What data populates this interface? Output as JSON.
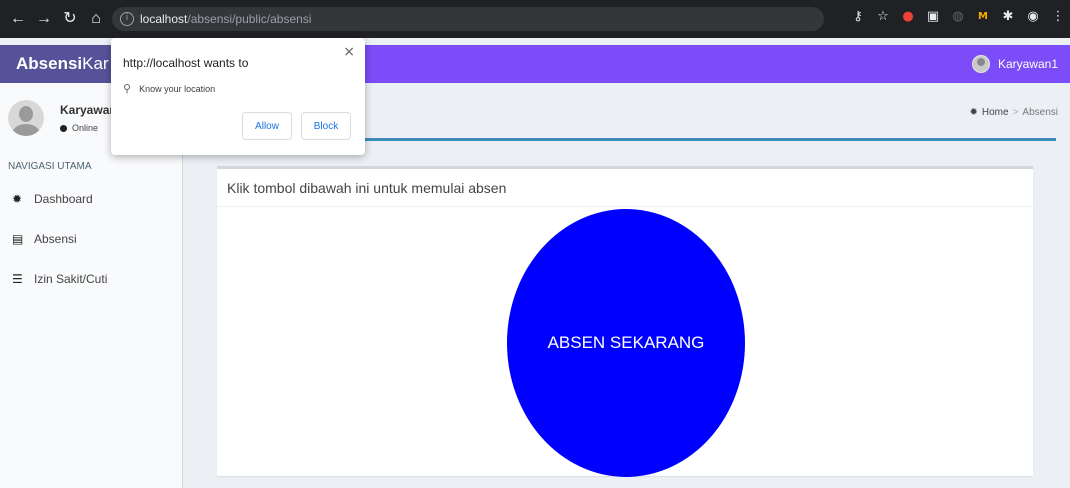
{
  "browser": {
    "url_host": "localhost",
    "url_path": "/absensi/public/absensi",
    "colors": {
      "chrome_bg": "#202124",
      "omnibox_bg": "#35363a"
    }
  },
  "app": {
    "logo_bold": "Absensi",
    "logo_light": "Kar",
    "user_name": "Karyawan1",
    "header_color": "#7b4cf7"
  },
  "sidebar": {
    "user_name": "Karyawan1",
    "user_status": "Online",
    "nav_header": "NAVIGASI UTAMA",
    "items": [
      {
        "label": "Dashboard",
        "icon": "dashboard-icon"
      },
      {
        "label": "Absensi",
        "icon": "table-icon"
      },
      {
        "label": "Izin Sakit/Cuti",
        "icon": "list-icon"
      }
    ]
  },
  "breadcrumb": {
    "home": "Home",
    "current": "Absensi"
  },
  "main": {
    "box_title": "Klik tombol dibawah ini untuk memulai absen",
    "absen_button": "ABSEN SEKARANG",
    "absen_button_color": "#0000ff"
  },
  "popup": {
    "title": "http://localhost wants to",
    "permission": "Know your location",
    "allow_label": "Allow",
    "block_label": "Block",
    "close_label": "×"
  }
}
